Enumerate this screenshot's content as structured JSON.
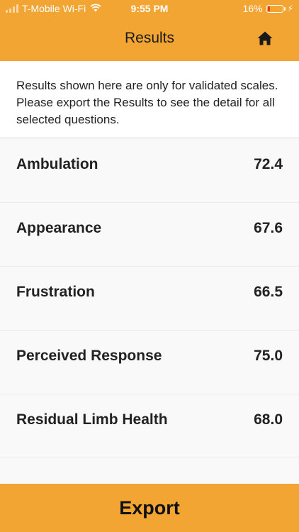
{
  "status_bar": {
    "carrier": "T-Mobile Wi-Fi",
    "time": "9:55 PM",
    "battery": "16%",
    "battery_level": 0.16
  },
  "nav": {
    "title": "Results",
    "home_icon": "home-icon"
  },
  "notice": {
    "text": "Results shown here are only for validated scales. Please export the Results to see the detail for all selected questions."
  },
  "results": [
    {
      "label": "Ambulation",
      "score": "72.4"
    },
    {
      "label": "Appearance",
      "score": "67.6"
    },
    {
      "label": "Frustration",
      "score": "66.5"
    },
    {
      "label": "Perceived Response",
      "score": "75.0"
    },
    {
      "label": "Residual Limb Health",
      "score": "68.0"
    }
  ],
  "export": {
    "label": "Export"
  },
  "colors": {
    "accent": "#f2a533",
    "background": "#f9f9f9"
  }
}
